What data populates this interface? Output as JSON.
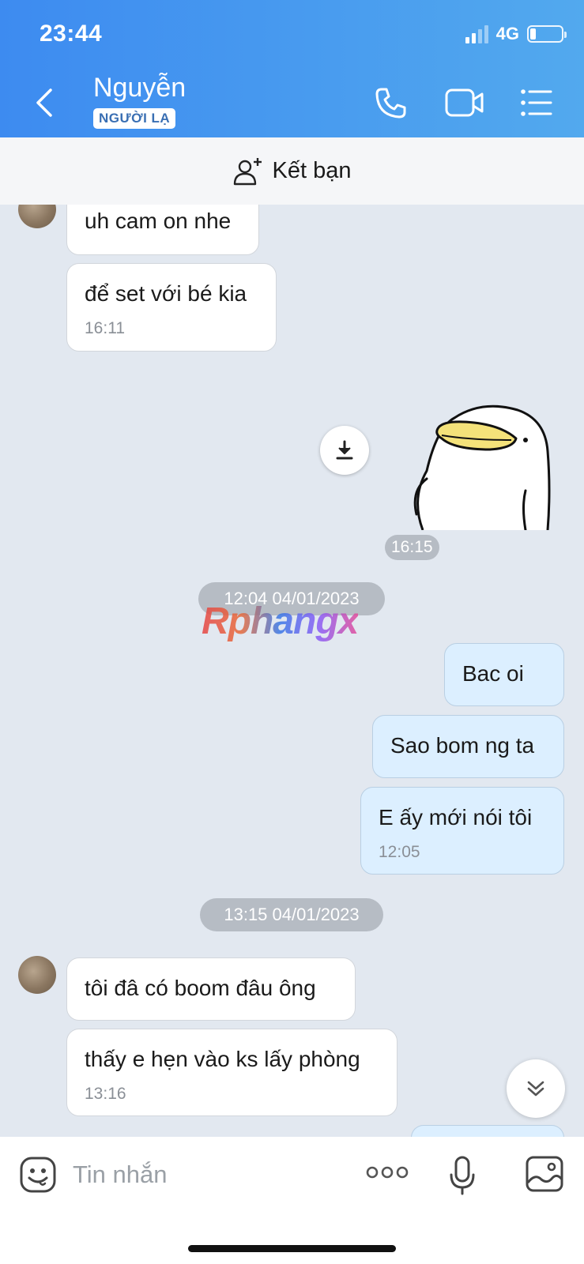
{
  "status_bar": {
    "time": "23:44",
    "network": "4G"
  },
  "header": {
    "contact_name": "Nguyễn",
    "badge": "NGƯỜI LẠ",
    "icons": [
      "back-icon",
      "phone-icon",
      "video-call-icon",
      "menu-list-icon"
    ]
  },
  "add_friend": {
    "label": "Kết bạn",
    "icon": "add-user-icon"
  },
  "messages": [
    {
      "from": "them",
      "text": "uh cam on nhe"
    },
    {
      "from": "them",
      "text": "để set với bé kia",
      "time": "16:11"
    },
    {
      "from": "me",
      "type": "sticker",
      "time": "16:15"
    },
    {
      "from": "me",
      "text": "Bac oi"
    },
    {
      "from": "me",
      "text": "Sao bom ng ta"
    },
    {
      "from": "me",
      "text": "E ấy mới nói tôi",
      "time": "12:05"
    },
    {
      "from": "them",
      "text": "tôi đâ có boom đâu ông"
    },
    {
      "from": "them",
      "text": "thấy e hẹn vào ks lấy phòng",
      "time": "13:16"
    }
  ],
  "date_separators": [
    "12:04 04/01/2023",
    "13:15 04/01/2023"
  ],
  "watermark": "Rphangx",
  "input_bar": {
    "placeholder": "Tin nhắn",
    "icons": [
      "emoji-icon",
      "more-icon",
      "microphone-icon",
      "image-icon"
    ]
  },
  "colors": {
    "header_start": "#3d8bf0",
    "header_end": "#52a9ee",
    "chat_bg": "#e2e8f0",
    "my_bubble": "#dcefff",
    "their_bubble": "#ffffff"
  }
}
